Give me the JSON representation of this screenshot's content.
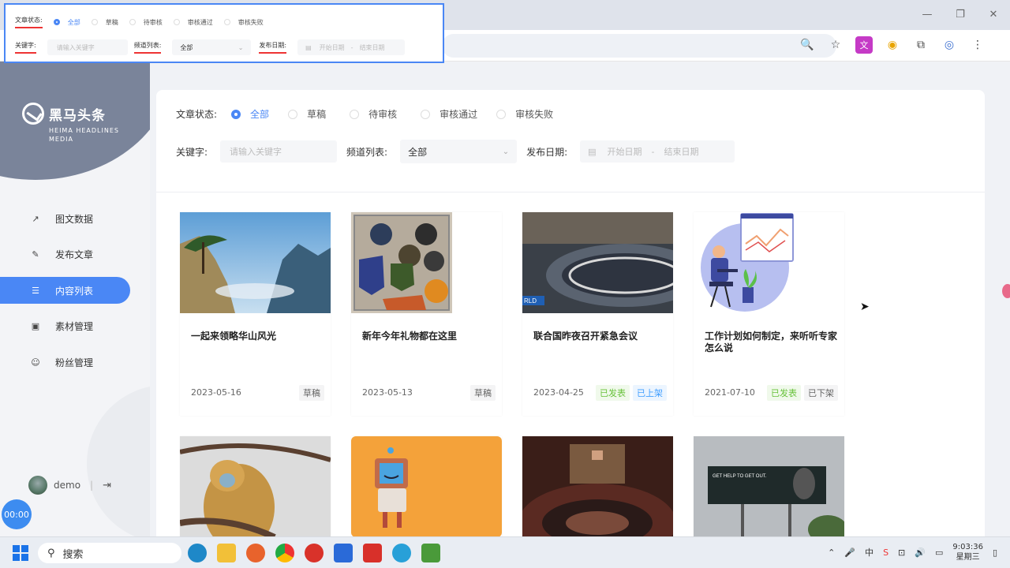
{
  "popup": {
    "status_label": "文章状态:",
    "statuses": [
      "全部",
      "草稿",
      "待审核",
      "审核通过",
      "审核失败"
    ],
    "keyword_label": "关键字:",
    "keyword_placeholder": "请输入关键字",
    "channel_label": "频道列表:",
    "channel_value": "全部",
    "date_label": "发布日期:",
    "date_start": "开始日期",
    "date_sep": "-",
    "date_end": "结束日期"
  },
  "brand": {
    "title": "黑马头条",
    "subtitle_line1": "HEIMA HEADLINES",
    "subtitle_line2": "MEDIA"
  },
  "nav": [
    {
      "label": "图文数据",
      "icon": "chart-icon"
    },
    {
      "label": "发布文章",
      "icon": "edit-icon"
    },
    {
      "label": "内容列表",
      "icon": "list-icon",
      "active": true
    },
    {
      "label": "素材管理",
      "icon": "image-icon"
    },
    {
      "label": "粉丝管理",
      "icon": "fans-icon"
    }
  ],
  "user": {
    "name": "demo",
    "sep": "|",
    "recording": "00:00"
  },
  "filters": {
    "status_label": "文章状态:",
    "statuses": [
      "全部",
      "草稿",
      "待审核",
      "审核通过",
      "审核失败"
    ],
    "keyword_label": "关键字:",
    "keyword_placeholder": "请输入关键字",
    "channel_label": "频道列表:",
    "channel_value": "全部",
    "date_label": "发布日期:",
    "date_start": "开始日期",
    "date_sep": "-",
    "date_end": "结束日期"
  },
  "articles": [
    {
      "title": "一起来领略华山风光",
      "date": "2023-05-16",
      "tags": [
        "草稿"
      ]
    },
    {
      "title": "新年今年礼物都在这里",
      "date": "2023-05-13",
      "tags": [
        "草稿"
      ]
    },
    {
      "title": "联合国昨夜召开紧急会议",
      "date": "2023-04-25",
      "tags": [
        "已发表",
        "已上架"
      ]
    },
    {
      "title": "工作计划如何制定，来听听专家怎么说",
      "date": "2021-07-10",
      "tags": [
        "已发表",
        "已下架"
      ]
    }
  ],
  "thumb_text": {
    "news_tag": "RLD",
    "billboard": "GET HELP TO GET OUT."
  },
  "taskbar": {
    "search": "搜索",
    "time": "9:03:36",
    "weekday": "星期三"
  },
  "colors": {
    "accent": "#4a87f5",
    "sidebar_circle": "#7a849a",
    "underline": "#ee3333"
  }
}
